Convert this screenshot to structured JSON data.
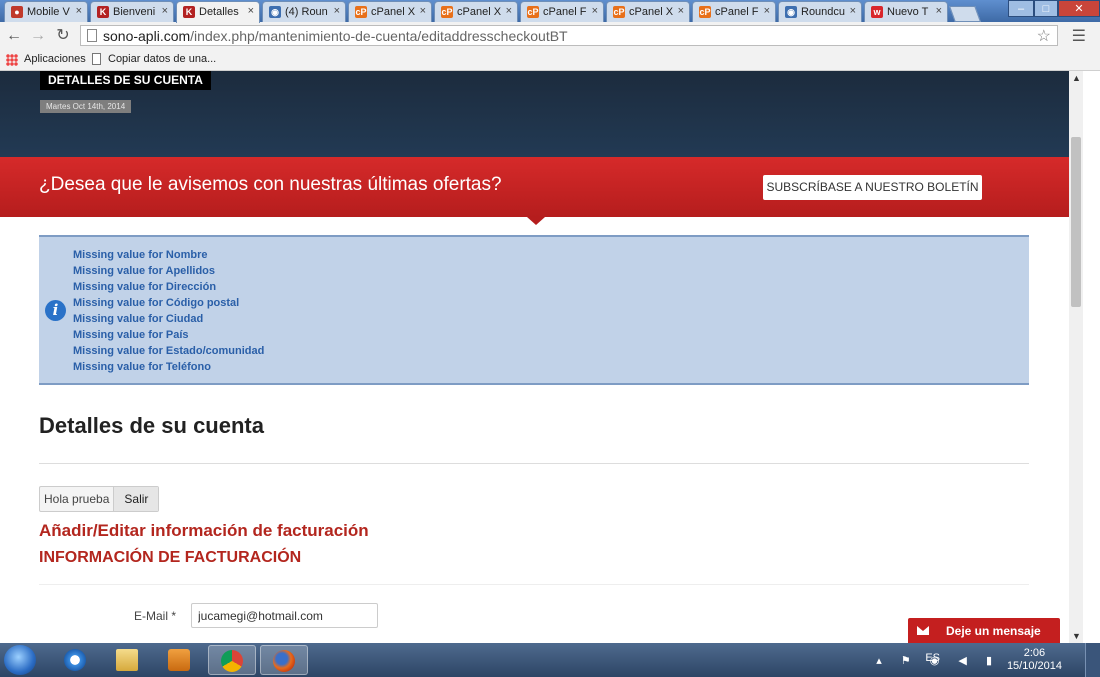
{
  "browser": {
    "tabs": [
      {
        "label": "Mobile V",
        "favicon": "red-ring-icon",
        "active": false
      },
      {
        "label": "Bienveni",
        "favicon": "red-logo-icon",
        "active": false
      },
      {
        "label": "Detalles",
        "favicon": "red-logo-icon",
        "active": true
      },
      {
        "label": "(4) Roun",
        "favicon": "roundcube-icon",
        "active": false
      },
      {
        "label": "cPanel X",
        "favicon": "cpanel-icon",
        "active": false
      },
      {
        "label": "cPanel X",
        "favicon": "cpanel-icon",
        "active": false
      },
      {
        "label": "cPanel F",
        "favicon": "cpanel-icon",
        "active": false
      },
      {
        "label": "cPanel X",
        "favicon": "cpanel-icon",
        "active": false
      },
      {
        "label": "cPanel F",
        "favicon": "cpanel-icon",
        "active": false
      },
      {
        "label": "Roundcu",
        "favicon": "roundcube-icon",
        "active": false
      },
      {
        "label": "Nuevo T",
        "favicon": "red-w-icon",
        "active": false
      }
    ],
    "tab_close": "×",
    "url_host": "sono-apli.com",
    "url_path": "/index.php/mantenimiento-de-cuenta/editaddresscheckoutBT",
    "bookmarks": {
      "apps": "Aplicaciones",
      "copy": "Copiar datos de una..."
    },
    "window_buttons": {
      "minimize": "–",
      "maximize": "□",
      "close": "✕"
    }
  },
  "hero": {
    "title": "DETALLES DE SU CUENTA",
    "date": "Martes Oct 14th, 2014"
  },
  "promo": {
    "text": "¿Desea que le avisemos con nuestras últimas ofertas?",
    "button": "SUBSCRÍBASE A NUESTRO BOLETÍN"
  },
  "info": {
    "icon": "info-icon",
    "messages": [
      "Missing value for Nombre",
      "Missing value for Apellidos",
      "Missing value for Dirección",
      "Missing value for Código postal",
      "Missing value for Ciudad",
      "Missing value for País",
      "Missing value for Estado/comunidad",
      "Missing value for Teléfono"
    ]
  },
  "account": {
    "title": "Detalles de su cuenta",
    "user": "Hola prueba",
    "logout": "Salir",
    "subtitle": "Añadir/Editar información de facturación",
    "section": "INFORMACIÓN DE FACTURACIÓN",
    "email_label": "E-Mail *",
    "email_value": "jucamegi@hotmail.com"
  },
  "chat": {
    "label": "Deje un mensaje"
  },
  "taskbar": {
    "language": "ES",
    "time": "2:06",
    "date": "15/10/2014"
  },
  "colors": {
    "promo_red": "#c62424",
    "info_bg": "#c1d2e8",
    "heading_red": "#b3261e",
    "link_blue": "#2a5fa8"
  }
}
